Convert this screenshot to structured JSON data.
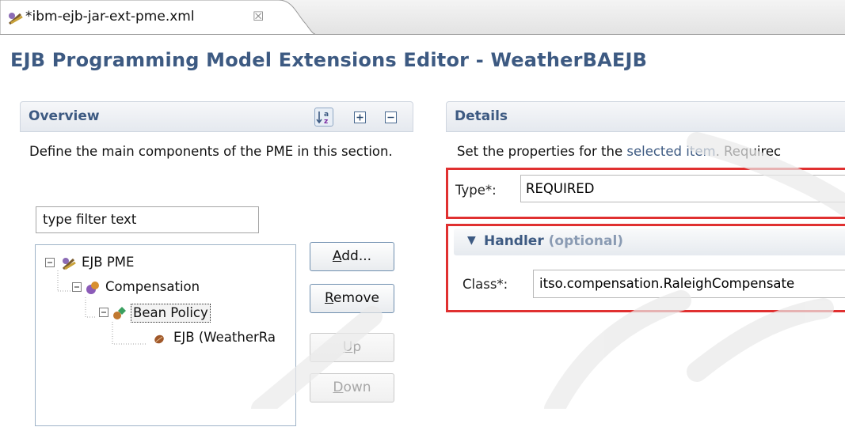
{
  "tab": {
    "title": "*ibm-ejb-jar-ext-pme.xml",
    "close_glyph": "☒",
    "icon": "pme-file-icon"
  },
  "editor": {
    "title": "EJB Programming Model Extensions Editor - WeatherBAEJB"
  },
  "overview": {
    "header": "Overview",
    "description": "Define the main components of the PME in this section.",
    "filter_value": "type filter text",
    "tree": [
      {
        "label": "EJB PME",
        "icon": "pme-icon",
        "expanded": true,
        "level": 0
      },
      {
        "label": "Compensation",
        "icon": "compensation-icon",
        "expanded": true,
        "level": 1
      },
      {
        "label": "Bean Policy",
        "icon": "bean-policy-icon",
        "expanded": true,
        "level": 2,
        "selected": true
      },
      {
        "label": "EJB (WeatherRa",
        "icon": "ejb-bean-icon",
        "level": 3
      }
    ],
    "buttons": {
      "add": {
        "mnemonic": "A",
        "rest": "dd..."
      },
      "remove": {
        "mnemonic": "R",
        "rest": "emove"
      },
      "up": {
        "mnemonic": "U",
        "rest": "p"
      },
      "down": {
        "mnemonic": "D",
        "rest": "own"
      }
    }
  },
  "details": {
    "header": "Details",
    "description_prefix": "Set the properties for the ",
    "description_accent": "selected item",
    "description_suffix": ". Requirec",
    "type_label": "Type*:",
    "type_value": "REQUIRED",
    "handler_title": "Handler",
    "handler_optional": "(optional)",
    "class_label": "Class*:",
    "class_value": "itso.compensation.RaleighCompensate"
  },
  "colors": {
    "title": "#3d5a82",
    "highlight": "#e03030",
    "tree_border": "#9fb3c8"
  }
}
